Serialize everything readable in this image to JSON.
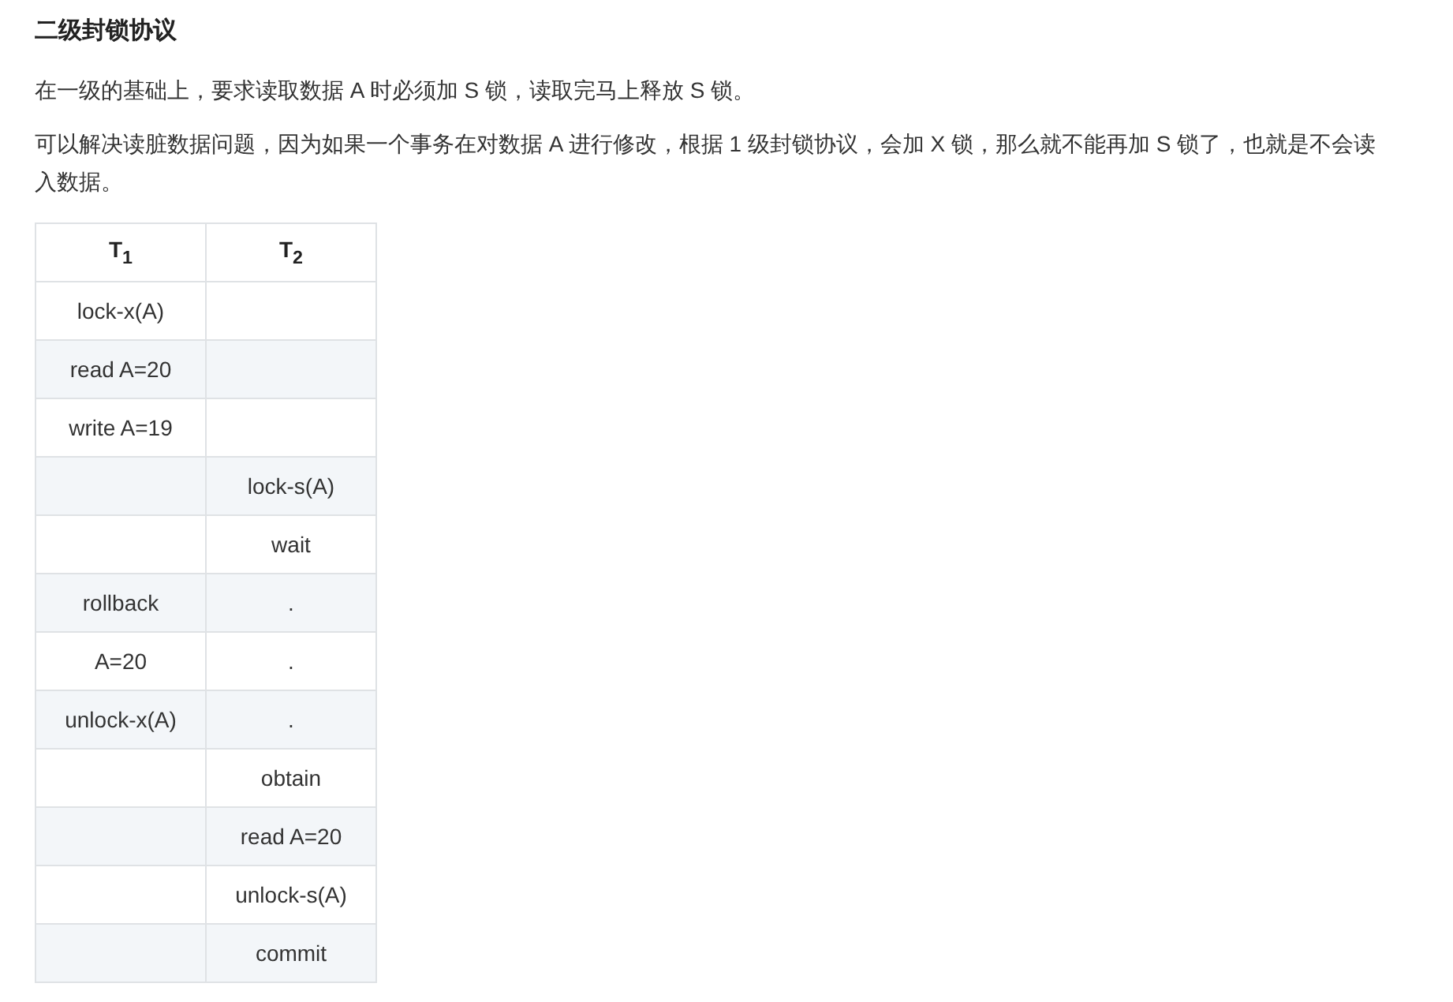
{
  "heading": "二级封锁协议",
  "paragraphs": [
    "在一级的基础上，要求读取数据 A 时必须加 S 锁，读取完马上释放 S 锁。",
    "可以解决读脏数据问题，因为如果一个事务在对数据 A 进行修改，根据 1 级封锁协议，会加 X 锁，那么就不能再加 S 锁了，也就是不会读入数据。"
  ],
  "table": {
    "columns": [
      "T$_{1}$",
      "T$_{2}$"
    ],
    "rows": [
      {
        "t1": "lock-x(A)"
      },
      {
        "t1": "read A=20"
      },
      {
        "t1": "write A=19"
      },
      {
        "t2": "lock-s(A)"
      },
      {
        "t2": "wait"
      },
      {
        "t1": "rollback",
        "t2": "."
      },
      {
        "t1": "A=20",
        "t2": "."
      },
      {
        "t1": "unlock-x(A)",
        "t2": "."
      },
      {
        "t2": "obtain"
      },
      {
        "t2": "read A=20"
      },
      {
        "t2": "unlock-s(A)"
      },
      {
        "t2": "commit"
      }
    ]
  }
}
